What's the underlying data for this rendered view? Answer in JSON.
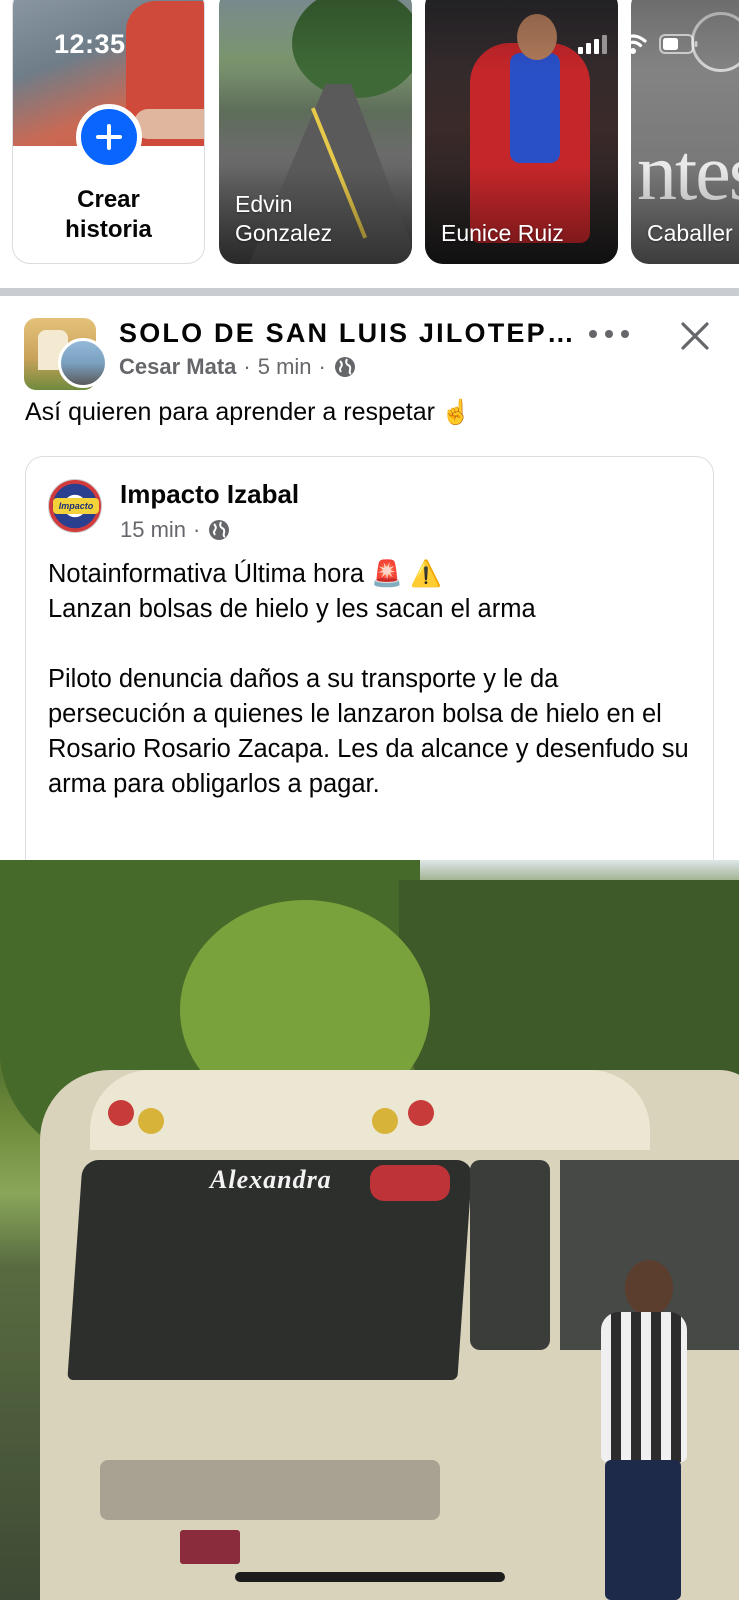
{
  "status_bar": {
    "time": "12:35"
  },
  "stories": {
    "create": {
      "label": "Crear\nhistoria",
      "icon": "plus-icon"
    },
    "items": [
      {
        "name": "Edvin\nGonzalez"
      },
      {
        "name": "Eunice Ruiz"
      },
      {
        "name": "Caballer"
      }
    ]
  },
  "post": {
    "group_name": "SOLO DE SAN LUIS JILOTEPEQUE",
    "author": "Cesar Mata",
    "time": "5 min",
    "caption": "Así quieren para aprender a respetar",
    "caption_emoji": "☝",
    "shared": {
      "page_name": "Impacto Izabal",
      "page_avatar_label": "Impacto",
      "time": "15 min",
      "text": "Notainformativa Última hora 🚨 ⚠️\nLanzan bolsas de hielo y les sacan el arma\n\nPiloto denuncia daños a su transporte y le da persecución a quienes le lanzaron bolsa de hielo en el Rosario Rosario Zacapa. Les da alcance y desenfudo su arma para obligarlos a pagar."
    },
    "photo": {
      "bus_label": "Alexandra"
    }
  },
  "colors": {
    "accent": "#0866ff",
    "secondary_text": "#65676b",
    "divider": "#c9ccd1"
  }
}
